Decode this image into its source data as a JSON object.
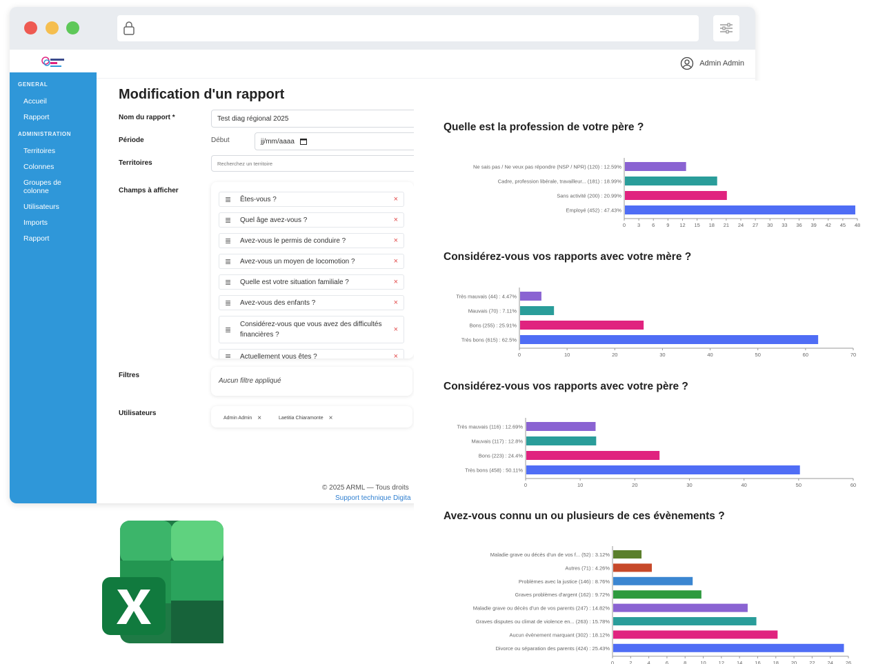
{
  "colors": {
    "sidebar": "#2f97d9",
    "accent_blue": "#4f6df5",
    "purple": "#8a63d2",
    "teal": "#2a9d9a",
    "pink": "#e0237f",
    "blue": "#4f6df5"
  },
  "window": {
    "traffic_lights": [
      "#ee5a52",
      "#f5be4f",
      "#5ec859"
    ],
    "address": ""
  },
  "header": {
    "user_name": "Admin Admin"
  },
  "sidebar": {
    "sections": [
      {
        "title": "GENERAL",
        "items": [
          "Accueil",
          "Rapport"
        ]
      },
      {
        "title": "ADMINISTRATION",
        "items": [
          "Territoires",
          "Colonnes",
          "Groupes de colonne",
          "Utilisateurs",
          "Imports",
          "Rapport"
        ]
      }
    ]
  },
  "form": {
    "title": "Modification d'un rapport",
    "name_label": "Nom du rapport *",
    "name_value": "Test diag régional 2025",
    "period_label": "Période",
    "period_start_label": "Début",
    "date_placeholder": "jj/mm/aaaa",
    "territories_label": "Territoires",
    "territories_placeholder": "Recherchez un territoire",
    "fields_label": "Champs à afficher",
    "fields": [
      "Êtes-vous ?",
      "Quel âge avez-vous ?",
      "Avez-vous le permis de conduire ?",
      "Avez-vous un moyen de locomotion ?",
      "Quelle est votre situation familiale ?",
      "Avez-vous des enfants ?",
      "Considérez-vous que vous avez des difficultés financières ?",
      "Actuellement vous êtes ?"
    ],
    "filters_label": "Filtres",
    "filters_value": "Aucun filtre appliqué",
    "users_label": "Utilisateurs",
    "users": [
      "Admin Admin",
      "Laetitia Chiaramonte"
    ],
    "remove_glyph": "×"
  },
  "footer": {
    "copyright": "© 2025 ARML — Tous droits",
    "support": "Support technique Digita"
  },
  "chart_data": [
    {
      "type": "bar",
      "orientation": "horizontal",
      "title": "Quelle est la profession de votre père ?",
      "categories": [
        "Ne sais pas / Ne veux pas répondre (NSP / NPR) (120) : 12.59%",
        "Cadre, profession libérale, travailleur... (181) : 18.99%",
        "Sans activité (200) : 20.99%",
        "Employé (452) : 47.43%"
      ],
      "values": [
        12.59,
        18.99,
        20.99,
        47.43
      ],
      "colors": [
        "#8a63d2",
        "#2a9d9a",
        "#e0237f",
        "#4f6df5"
      ],
      "xlim": [
        0,
        48
      ],
      "xticks": [
        0,
        3,
        6,
        9,
        12,
        15,
        18,
        21,
        24,
        27,
        30,
        33,
        36,
        39,
        42,
        45,
        48
      ]
    },
    {
      "type": "bar",
      "orientation": "horizontal",
      "title": "Considérez-vous vos rapports avec votre mère ?",
      "categories": [
        "Très mauvais (44) : 4.47%",
        "Mauvais (70) : 7.11%",
        "Bons (255) : 25.91%",
        "Très bons (615) : 62.5%"
      ],
      "values": [
        4.47,
        7.11,
        25.91,
        62.5
      ],
      "colors": [
        "#8a63d2",
        "#2a9d9a",
        "#e0237f",
        "#4f6df5"
      ],
      "xlim": [
        0,
        70
      ],
      "xticks": [
        0,
        10,
        20,
        30,
        40,
        50,
        60,
        70
      ]
    },
    {
      "type": "bar",
      "orientation": "horizontal",
      "title": "Considérez-vous vos rapports avec votre père ?",
      "categories": [
        "Très mauvais (116) : 12.69%",
        "Mauvais (117) : 12.8%",
        "Bons (223) : 24.4%",
        "Très bons (458) : 50.11%"
      ],
      "values": [
        12.69,
        12.8,
        24.4,
        50.11
      ],
      "colors": [
        "#8a63d2",
        "#2a9d9a",
        "#e0237f",
        "#4f6df5"
      ],
      "xlim": [
        0,
        60
      ],
      "xticks": [
        0,
        10,
        20,
        30,
        40,
        50,
        60
      ]
    },
    {
      "type": "bar",
      "orientation": "horizontal",
      "title": "Avez-vous connu un ou plusieurs de ces évènements ?",
      "categories": [
        "Maladie grave ou décès d'un de vos f... (52) : 3.12%",
        "Autres (71) : 4.26%",
        "Problèmes avec la justice (146) : 8.76%",
        "Graves problèmes d'argent (162) : 9.72%",
        "Maladie grave ou décès d'un de vos parents (247) : 14.82%",
        "Graves disputes ou climat de violence en... (263) : 15.78%",
        "Aucun évènement marquant (302) : 18.12%",
        "Divorce ou séparation des parents (424) : 25.43%"
      ],
      "values": [
        3.12,
        4.26,
        8.76,
        9.72,
        14.82,
        15.78,
        18.12,
        25.43
      ],
      "colors": [
        "#5b7f2c",
        "#c7492a",
        "#3b86d1",
        "#2e9a3e",
        "#8a63d2",
        "#2a9d9a",
        "#e0237f",
        "#4f6df5"
      ],
      "xlim": [
        0,
        26
      ],
      "xticks": [
        0,
        2,
        4,
        6,
        8,
        10,
        12,
        14,
        16,
        18,
        20,
        22,
        24,
        26
      ]
    }
  ]
}
